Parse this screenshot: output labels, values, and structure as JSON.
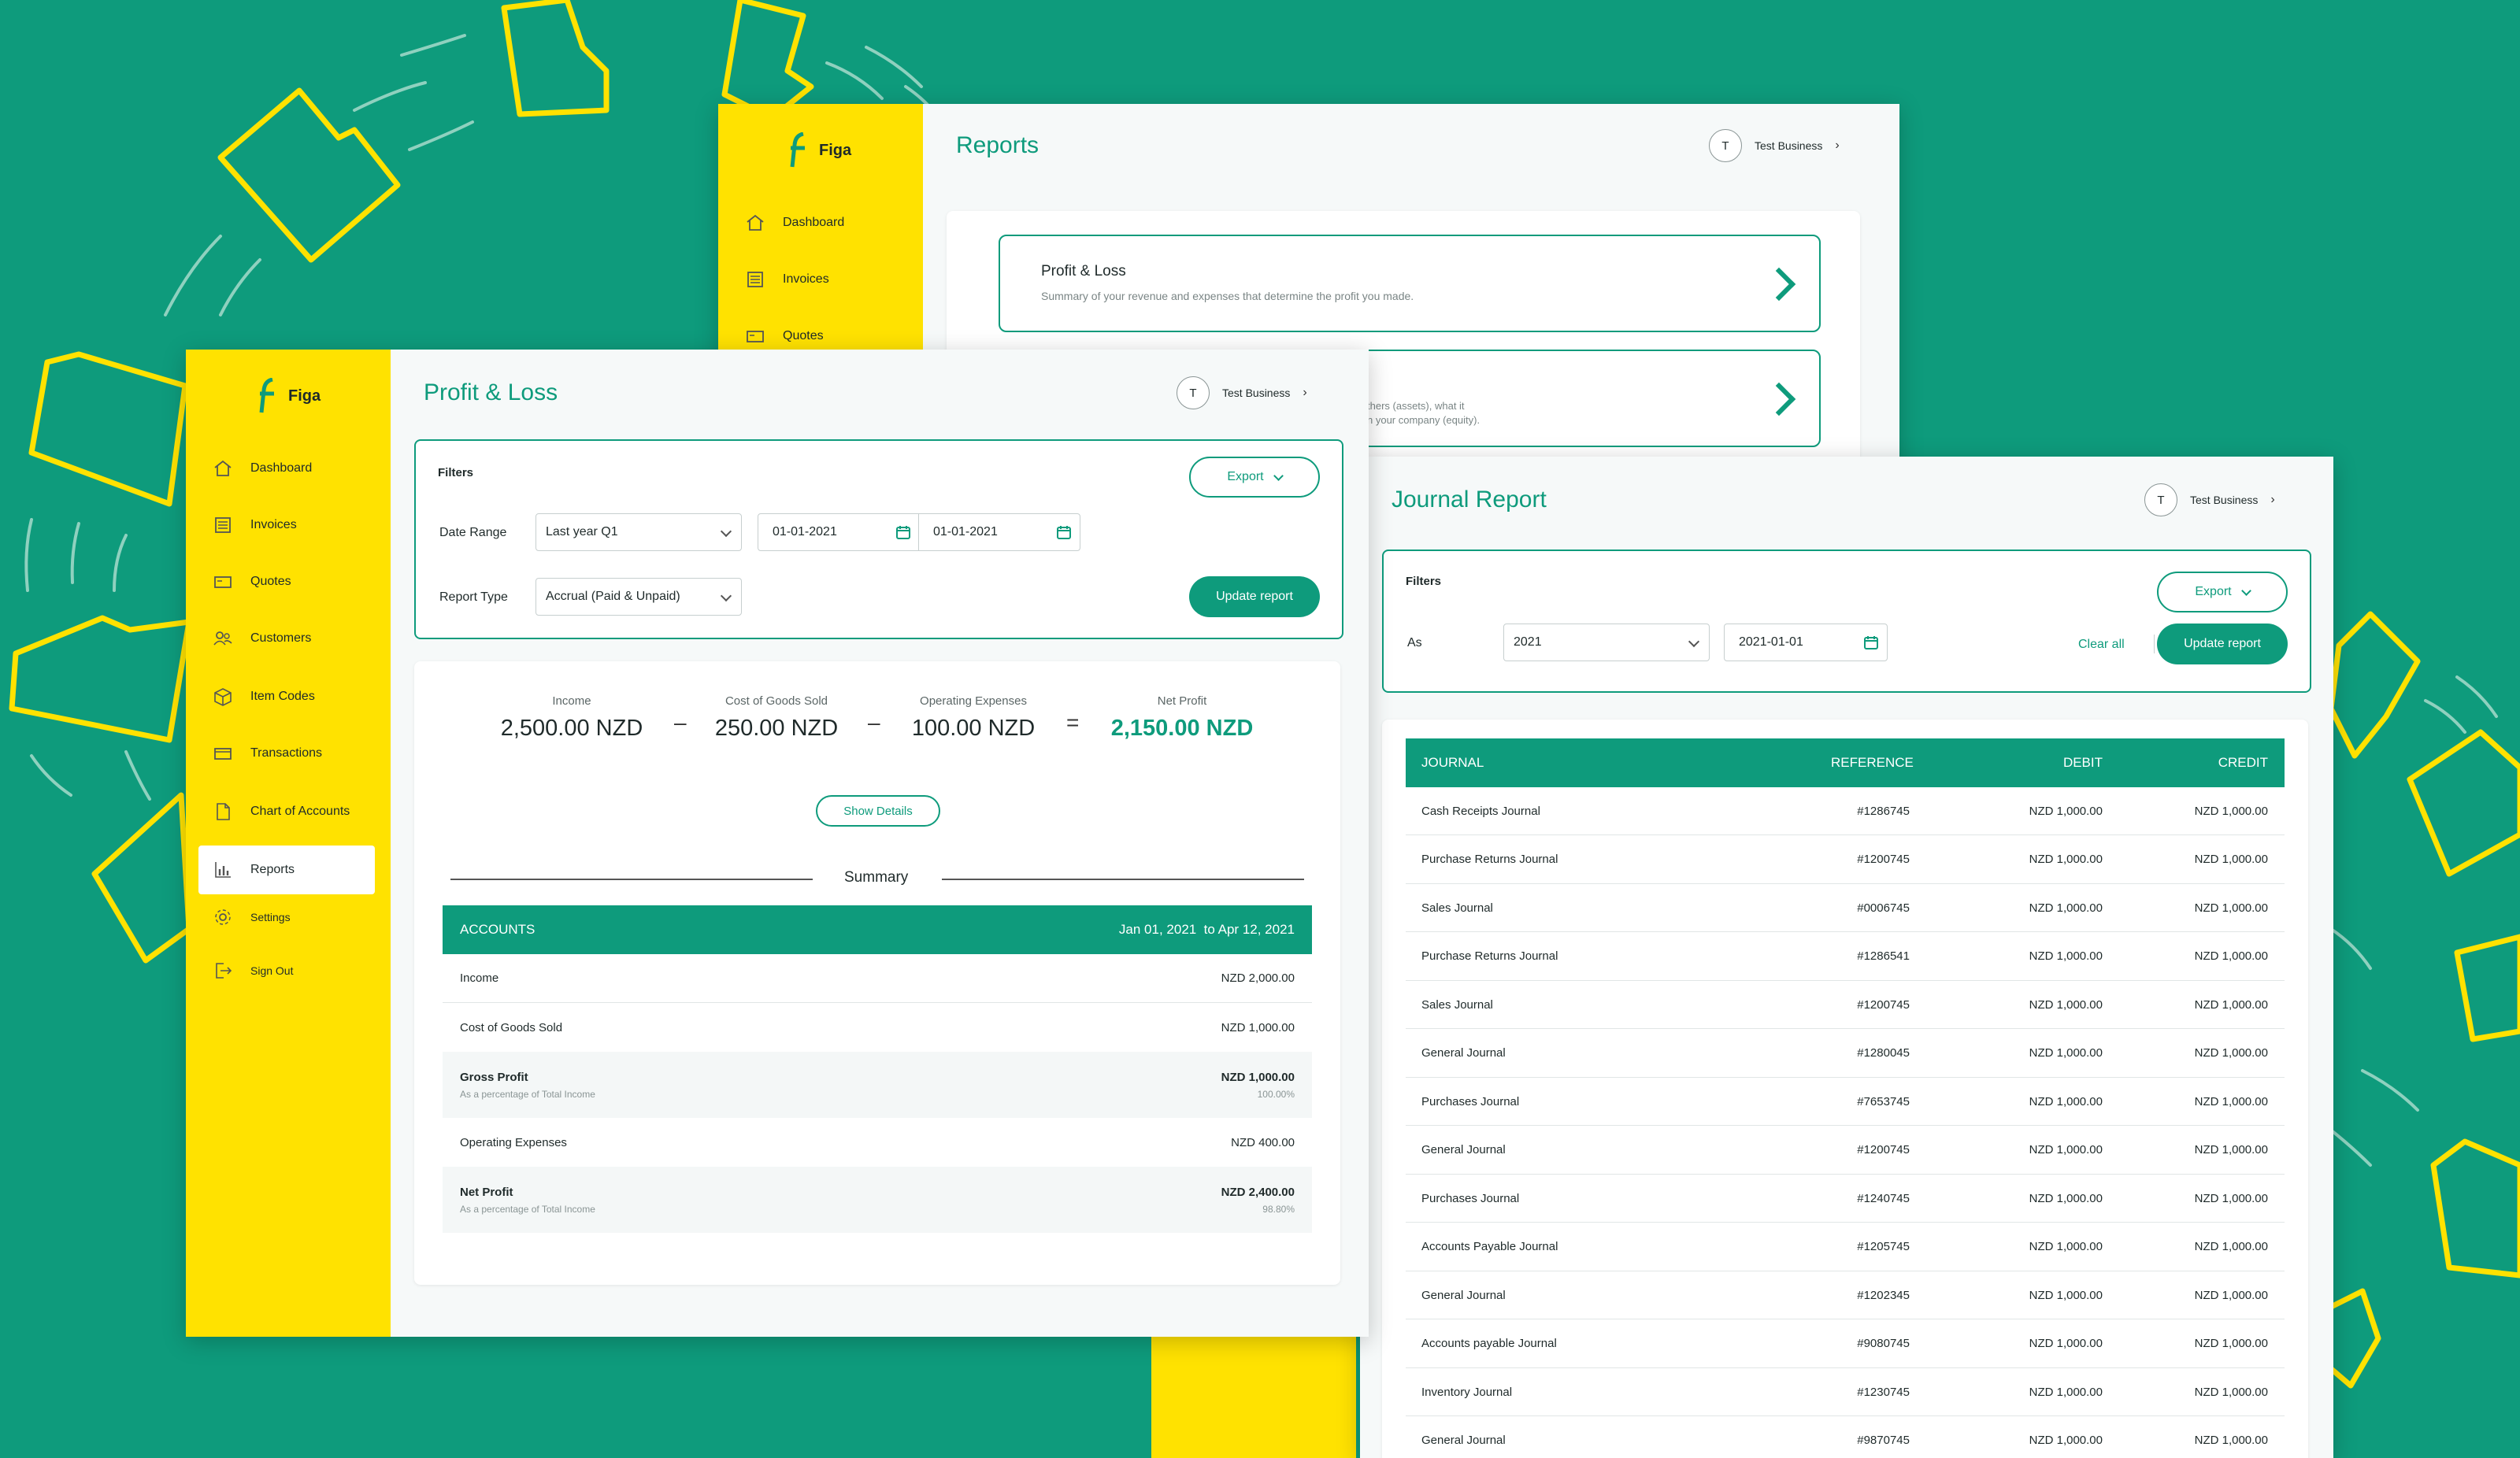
{
  "brand": {
    "name": "Figa",
    "colors": {
      "green": "#0e9b7c",
      "yellow": "#ffe200"
    }
  },
  "user": {
    "avatar_letter": "T",
    "name": "Test Business"
  },
  "nav": {
    "items": [
      {
        "label": "Dashboard",
        "icon": "home-icon"
      },
      {
        "label": "Invoices",
        "icon": "invoice-icon"
      },
      {
        "label": "Quotes",
        "icon": "quote-icon"
      },
      {
        "label": "Customers",
        "icon": "customers-icon"
      },
      {
        "label": "Item Codes",
        "icon": "box-icon"
      },
      {
        "label": "Transactions",
        "icon": "transactions-icon"
      },
      {
        "label": "Chart of Accounts",
        "icon": "document-icon"
      },
      {
        "label": "Reports",
        "icon": "bar-chart-icon",
        "active": true
      },
      {
        "label": "Settings",
        "icon": "gear-icon"
      },
      {
        "label": "Sign Out",
        "icon": "sign-out-icon"
      }
    ]
  },
  "reports_window": {
    "title": "Reports",
    "cards": [
      {
        "title": "Profit & Loss",
        "desc": "Summary of your revenue and expenses that determine the profit you made."
      },
      {
        "title": "",
        "desc_line1": "thers (assets), what it",
        "desc_line2": "n your company (equity)."
      }
    ]
  },
  "pl_window": {
    "title": "Profit & Loss",
    "filters": {
      "heading": "Filters",
      "export_label": "Export",
      "date_range_label": "Date Range",
      "date_range_value": "Last year Q1",
      "date_from": "01-01-2021",
      "date_to": "01-01-2021",
      "report_type_label": "Report Type",
      "report_type_value": "Accrual (Paid & Unpaid)",
      "update_label": "Update report"
    },
    "metrics": [
      {
        "label": "Income",
        "value": "2,500.00 NZD"
      },
      {
        "label": "Cost of Goods Sold",
        "value": "250.00 NZD"
      },
      {
        "label": "Operating Expenses",
        "value": "100.00 NZD"
      },
      {
        "label": "Net Profit",
        "value": "2,150.00 NZD"
      }
    ],
    "operators": [
      "–",
      "–",
      "="
    ],
    "show_details_label": "Show Details",
    "summary_label": "Summary",
    "table": {
      "header_left": "ACCOUNTS",
      "header_right": "Jan 01, 2021  to Apr 12, 2021",
      "rows": [
        {
          "name": "Income",
          "value": "NZD 2,000.00"
        },
        {
          "name": "Cost of Goods Sold",
          "value": "NZD 1,000.00"
        },
        {
          "name": "Gross Profit",
          "value": "NZD 1,000.00",
          "sub": "As a percentage of Total Income",
          "pct": "100.00%"
        },
        {
          "name": "Operating Expenses",
          "value": "NZD 400.00"
        },
        {
          "name": "Net Profit",
          "value": "NZD 2,400.00",
          "sub": "As a percentage of Total Income",
          "pct": "98.80%"
        }
      ]
    }
  },
  "journal_window": {
    "title": "Journal Report",
    "filters": {
      "heading": "Filters",
      "export_label": "Export",
      "as_label": "As",
      "as_value": "2021",
      "date_value": "2021-01-01",
      "clear_label": "Clear all",
      "update_label": "Update report"
    },
    "columns": [
      "JOURNAL",
      "REFERENCE",
      "DEBIT",
      "CREDIT"
    ],
    "rows": [
      [
        "Cash Receipts Journal",
        "#1286745",
        "NZD 1,000.00",
        "NZD 1,000.00"
      ],
      [
        "Purchase Returns Journal",
        "#1200745",
        "NZD 1,000.00",
        "NZD 1,000.00"
      ],
      [
        "Sales Journal",
        "#0006745",
        "NZD 1,000.00",
        "NZD 1,000.00"
      ],
      [
        "Purchase Returns Journal",
        "#1286541",
        "NZD 1,000.00",
        "NZD 1,000.00"
      ],
      [
        "Sales Journal",
        "#1200745",
        "NZD 1,000.00",
        "NZD 1,000.00"
      ],
      [
        "General Journal",
        "#1280045",
        "NZD 1,000.00",
        "NZD 1,000.00"
      ],
      [
        "Purchases Journal",
        "#7653745",
        "NZD 1,000.00",
        "NZD 1,000.00"
      ],
      [
        "General Journal",
        "#1200745",
        "NZD 1,000.00",
        "NZD 1,000.00"
      ],
      [
        "Purchases Journal",
        "#1240745",
        "NZD 1,000.00",
        "NZD 1,000.00"
      ],
      [
        "Accounts Payable Journal",
        "#1205745",
        "NZD 1,000.00",
        "NZD 1,000.00"
      ],
      [
        "General Journal",
        "#1202345",
        "NZD 1,000.00",
        "NZD 1,000.00"
      ],
      [
        "Accounts payable Journal",
        "#9080745",
        "NZD 1,000.00",
        "NZD 1,000.00"
      ],
      [
        "Inventory Journal",
        "#1230745",
        "NZD 1,000.00",
        "NZD 1,000.00"
      ],
      [
        "General Journal",
        "#9870745",
        "NZD 1,000.00",
        "NZD 1,000.00"
      ]
    ]
  }
}
